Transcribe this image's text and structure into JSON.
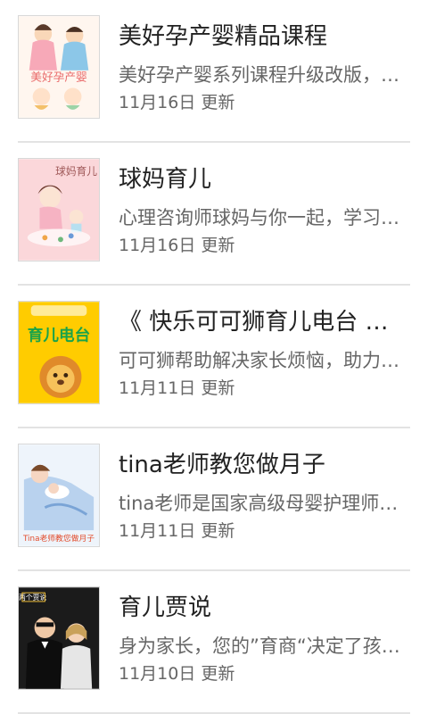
{
  "courses": [
    {
      "title": "美好孕产婴精品课程",
      "description": "美好孕产婴系列课程升级改版，将为您提供更专业的服务",
      "date": "11月16日",
      "update_label": "更新",
      "thumb_text": "美好孕产婴",
      "thumb_icon": "pregnancy-family-cartoon"
    },
    {
      "title": "球妈育儿",
      "description": "心理咨询师球妈与你一起，学习带娃",
      "date": "11月16日",
      "update_label": "更新",
      "thumb_text": "球妈育儿",
      "thumb_icon": "mother-baby-cartoon"
    },
    {
      "title": "《 快乐可可狮育儿电台 》-分月龄育儿",
      "description": "可可狮帮助解决家长烦恼，助力宝宝成长",
      "date": "11月11日",
      "update_label": "更新",
      "thumb_text": "育儿电台",
      "thumb_icon": "lion-cartoon"
    },
    {
      "title": "tina老师教您做月子",
      "description": "tina老师是国家高级母婴护理师，为您讲解",
      "date": "11月11日",
      "update_label": "更新",
      "thumb_text": "Tina老师教您做月子",
      "thumb_icon": "mother-newborn-illustration"
    },
    {
      "title": "育儿贾说",
      "description": "身为家长，您的”育商“决定了孩子的未来",
      "date": "11月10日",
      "update_label": "更新",
      "thumb_text": "两个贾说",
      "thumb_icon": "hosts-photo"
    }
  ]
}
